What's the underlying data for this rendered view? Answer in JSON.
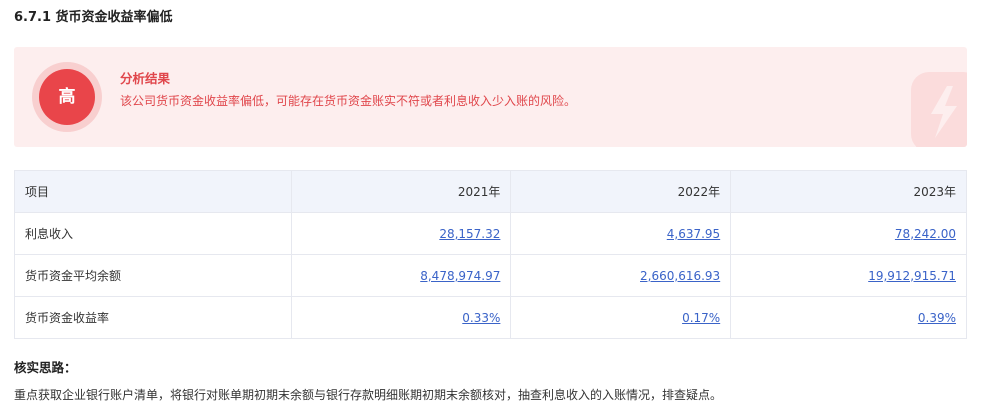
{
  "section": {
    "title": "6.7.1 货币资金收益率偏低"
  },
  "alert": {
    "level": "高",
    "title": "分析结果",
    "text": "该公司货币资金收益率偏低，可能存在货币资金账实不符或者利息收入少入账的风险。",
    "accent_color": "#e9454a",
    "background_color": "#fdeeee"
  },
  "table": {
    "headers": [
      "项目",
      "2021年",
      "2022年",
      "2023年"
    ],
    "rows": [
      {
        "label": "利息收入",
        "values": [
          "28,157.32",
          "4,637.95",
          "78,242.00"
        ]
      },
      {
        "label": "货币资金平均余额",
        "values": [
          "8,478,974.97",
          "2,660,616.93",
          "19,912,915.71"
        ]
      },
      {
        "label": "货币资金收益率",
        "values": [
          "0.33%",
          "0.17%",
          "0.39%"
        ]
      }
    ]
  },
  "verification": {
    "title": "核实思路：",
    "text": "重点获取企业银行账户清单，将银行对账单期初期末余额与银行存款明细账期初期末余额核对，抽查利息收入的入账情况，排查疑点。"
  }
}
